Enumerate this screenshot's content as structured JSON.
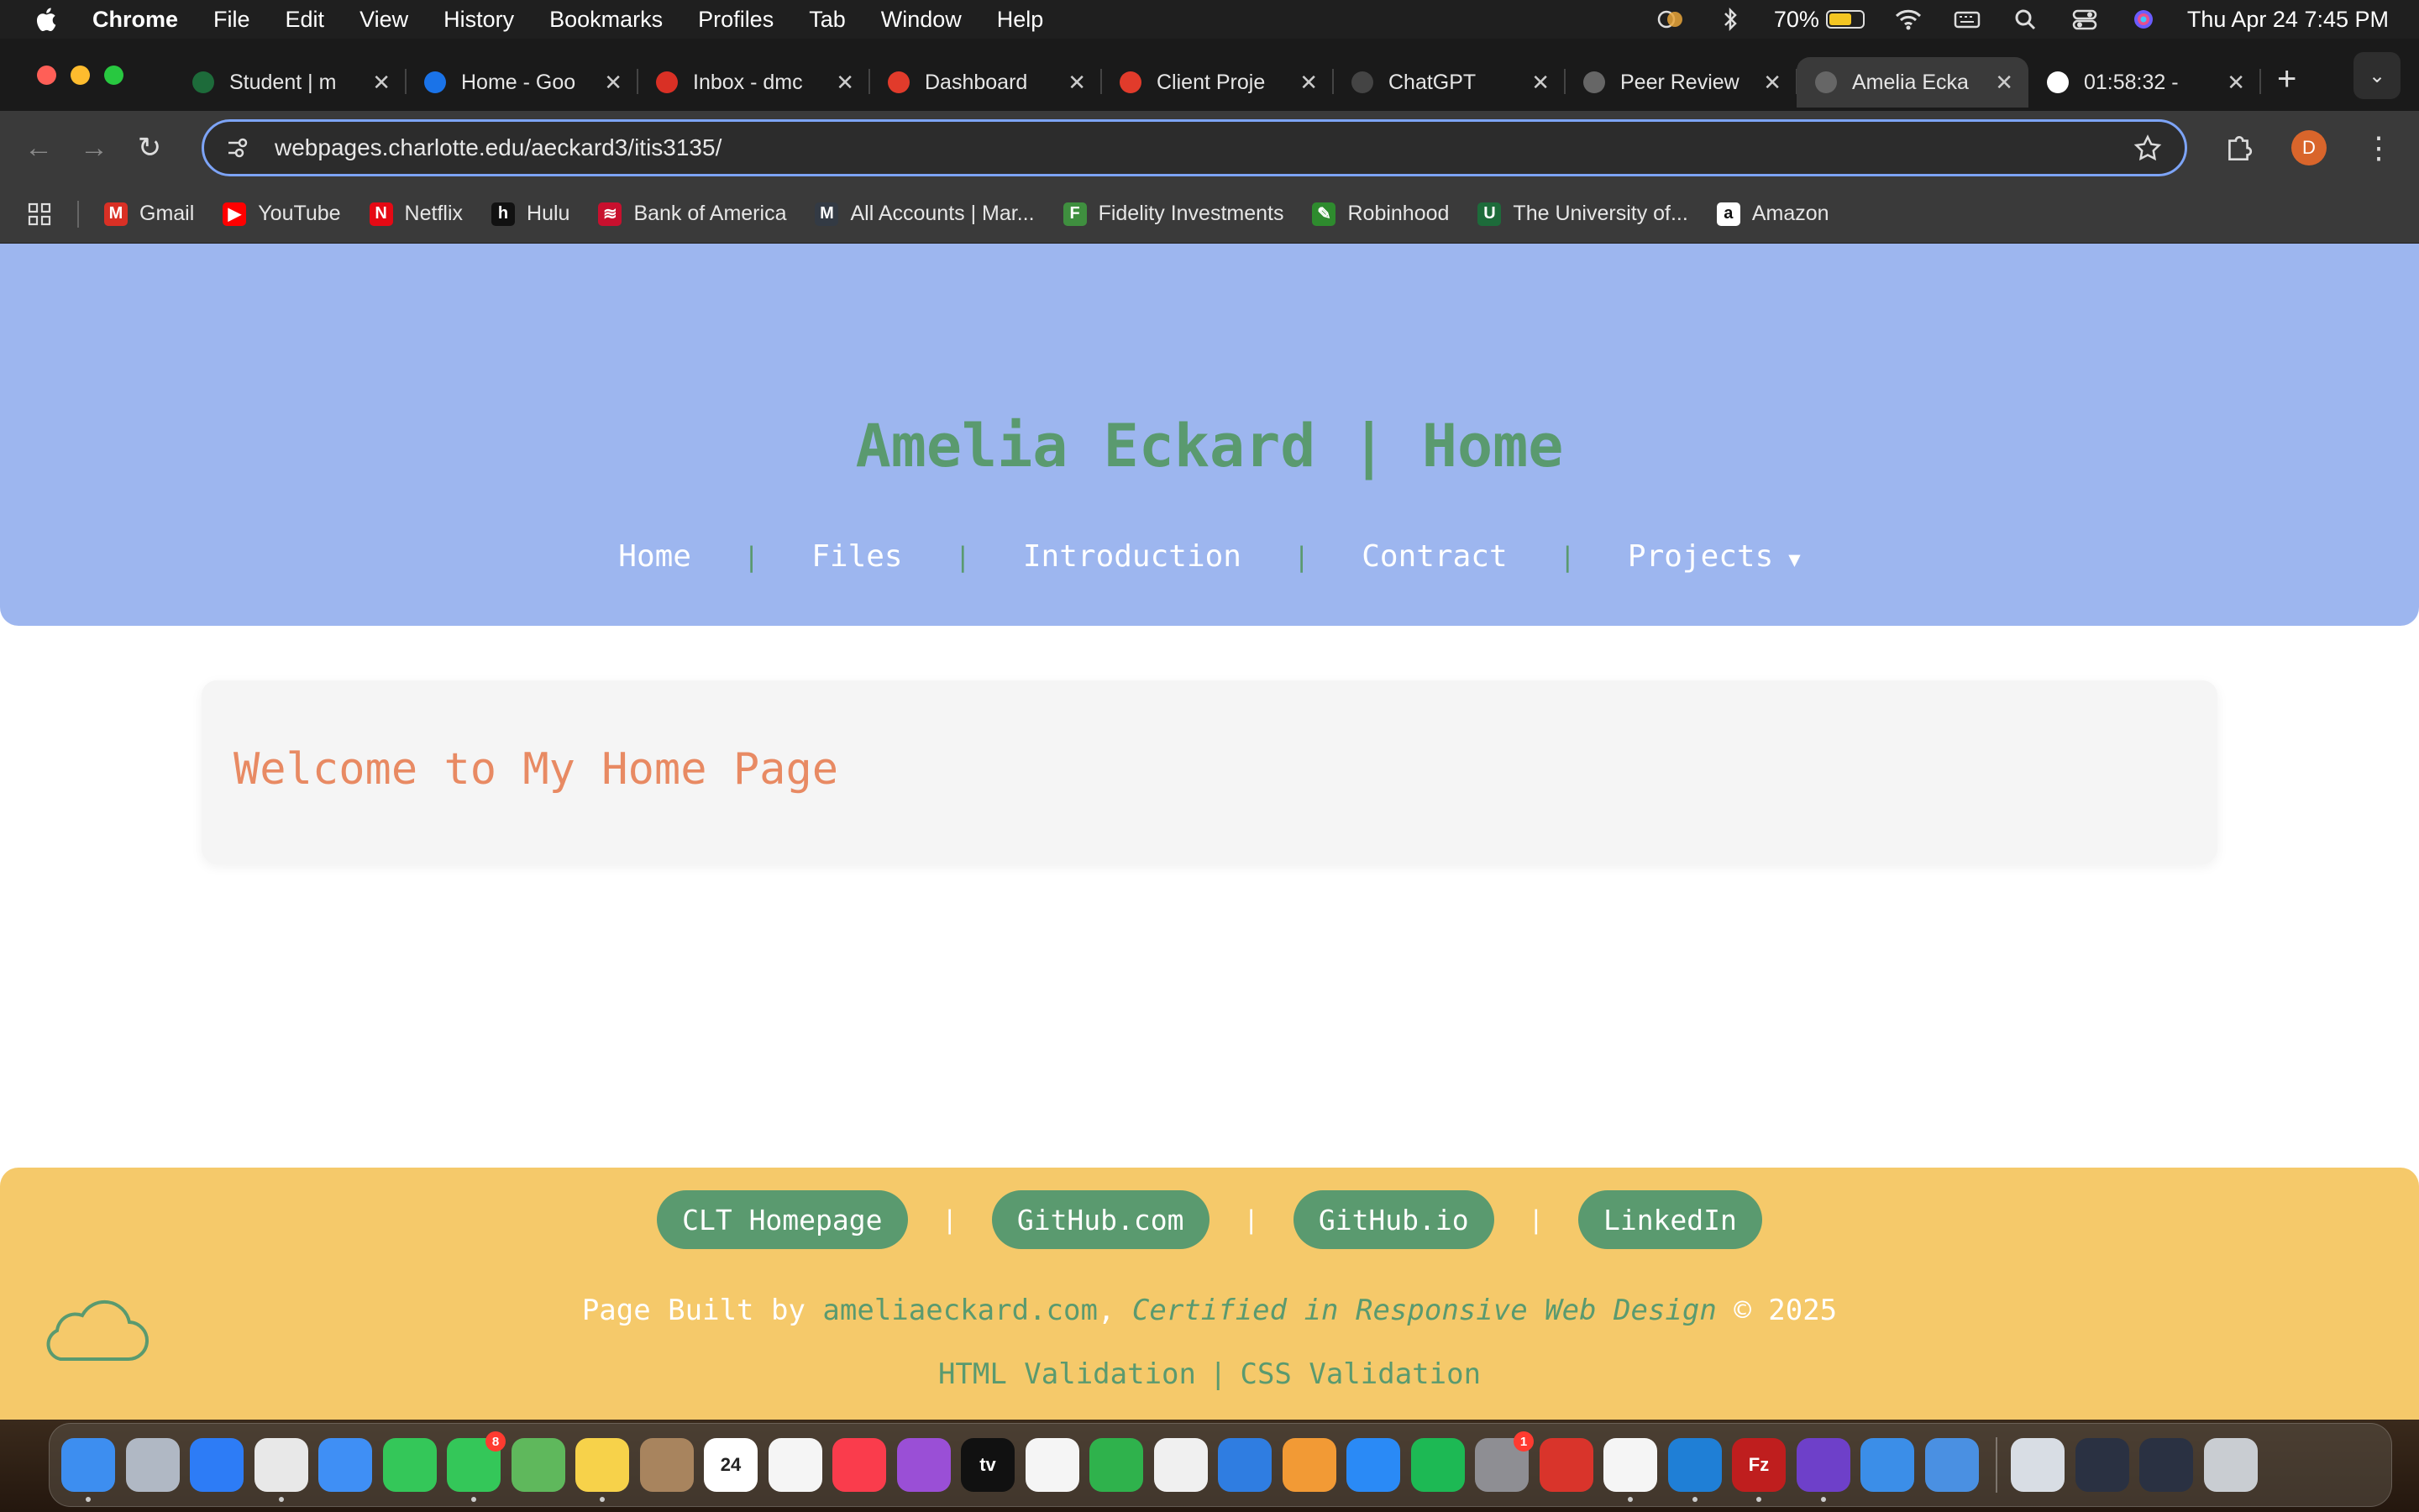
{
  "menubar": {
    "app": "Chrome",
    "items": [
      "File",
      "Edit",
      "View",
      "History",
      "Bookmarks",
      "Profiles",
      "Tab",
      "Window",
      "Help"
    ],
    "battery_percent": "70%",
    "battery_level": 0.7,
    "datetime": "Thu Apr 24  7:45 PM"
  },
  "tabs": [
    {
      "label": "Student | m",
      "icon": "student-icon",
      "color": "#1d6b3a",
      "active": false
    },
    {
      "label": "Home - Goo",
      "icon": "google-drive-icon",
      "color": "#1a73e8",
      "active": false
    },
    {
      "label": "Inbox - dmc",
      "icon": "gmail-icon",
      "color": "#d93025",
      "active": false
    },
    {
      "label": "Dashboard",
      "icon": "canvas-icon",
      "color": "#e13b2b",
      "active": false
    },
    {
      "label": "Client Proje",
      "icon": "canvas-icon",
      "color": "#e13b2b",
      "active": false
    },
    {
      "label": "ChatGPT",
      "icon": "openai-icon",
      "color": "#444444",
      "active": false
    },
    {
      "label": "Peer Review",
      "icon": "globe-icon",
      "color": "#666666",
      "active": false
    },
    {
      "label": "Amelia Ecka",
      "icon": "globe-icon",
      "color": "#666666",
      "active": true
    },
    {
      "label": "01:58:32 - ",
      "icon": "google-icon",
      "color": "#ffffff",
      "active": false
    }
  ],
  "address_bar": {
    "url": "webpages.charlotte.edu/aeckard3/itis3135/"
  },
  "profile_initial": "D",
  "bookmarks": [
    {
      "label": "Gmail",
      "icon": "gmail-icon",
      "color": "#d93025",
      "glyph": "M"
    },
    {
      "label": "YouTube",
      "icon": "youtube-icon",
      "color": "#ff0000",
      "glyph": "▶"
    },
    {
      "label": "Netflix",
      "icon": "netflix-icon",
      "color": "#e50914",
      "glyph": "N"
    },
    {
      "label": "Hulu",
      "icon": "hulu-icon",
      "color": "#111111",
      "glyph": "h"
    },
    {
      "label": "Bank of America",
      "icon": "bank-of-america-icon",
      "color": "#c8102e",
      "glyph": "≋"
    },
    {
      "label": "All Accounts | Mar...",
      "icon": "marcus-icon",
      "color": "#333a44",
      "glyph": "M"
    },
    {
      "label": "Fidelity Investments",
      "icon": "fidelity-icon",
      "color": "#3f8f3f",
      "glyph": "F"
    },
    {
      "label": "Robinhood",
      "icon": "robinhood-icon",
      "color": "#2e8b2e",
      "glyph": "✎"
    },
    {
      "label": "The University of...",
      "icon": "unc-charlotte-icon",
      "color": "#1d6b3a",
      "glyph": "U"
    },
    {
      "label": "Amazon",
      "icon": "amazon-icon",
      "color": "#ffffff",
      "glyph": "a"
    }
  ],
  "site": {
    "title": "Amelia Eckard | Home",
    "nav": [
      "Home",
      "Files",
      "Introduction",
      "Contract",
      "Projects"
    ],
    "nav_caret": "▼",
    "nav_separator": "|",
    "welcome_heading": "Welcome to My Home Page",
    "footer": {
      "links": [
        "CLT Homepage",
        "GitHub.com",
        "GitHub.io",
        "LinkedIn"
      ],
      "credit_prefix": "Page Built by ",
      "credit_link": "ameliaeckard.com",
      "credit_comma": ", ",
      "credit_cert": "Certified in Responsive Web Design",
      "credit_suffix": " © 2025",
      "validation": [
        "HTML Validation",
        "CSS Validation"
      ]
    }
  },
  "colors": {
    "header_bg": "#9db6ef",
    "accent_green": "#5a9a6f",
    "welcome_orange": "#e88a63",
    "footer_bg": "#f5c96a"
  },
  "dock": {
    "apps": [
      {
        "name": "finder-icon",
        "color": "#3d8ef0",
        "running": true
      },
      {
        "name": "launchpad-icon",
        "color": "#b0b8c4",
        "running": false
      },
      {
        "name": "safari-icon",
        "color": "#2d7cf6",
        "running": false
      },
      {
        "name": "chrome-icon",
        "color": "#e8e8e8",
        "running": true
      },
      {
        "name": "mail-icon",
        "color": "#3f8ff5",
        "running": false
      },
      {
        "name": "facetime-icon",
        "color": "#34c759",
        "running": false
      },
      {
        "name": "messages-icon",
        "color": "#34c759",
        "running": true,
        "badge": "8"
      },
      {
        "name": "maps-icon",
        "color": "#5fb85c",
        "running": false
      },
      {
        "name": "notes-icon",
        "color": "#f7d24a",
        "running": true
      },
      {
        "name": "contacts-icon",
        "color": "#a8845e",
        "running": false
      },
      {
        "name": "calendar-icon",
        "color": "#ffffff",
        "running": false,
        "label": "24"
      },
      {
        "name": "reminders-icon",
        "color": "#f5f5f5",
        "running": false
      },
      {
        "name": "music-icon",
        "color": "#fa3c4c",
        "running": false
      },
      {
        "name": "podcasts-icon",
        "color": "#9a4fd6",
        "running": false
      },
      {
        "name": "apple-tv-icon",
        "color": "#111111",
        "running": false,
        "label": "tv"
      },
      {
        "name": "news-icon",
        "color": "#f5f5f5",
        "running": false
      },
      {
        "name": "numbers-icon",
        "color": "#2fb24c",
        "running": false
      },
      {
        "name": "photos-icon",
        "color": "#f0f0f0",
        "running": false
      },
      {
        "name": "keynote-icon",
        "color": "#2f7de1",
        "running": false
      },
      {
        "name": "pages-icon",
        "color": "#f29a35",
        "running": false
      },
      {
        "name": "app-store-icon",
        "color": "#2a8af6",
        "running": false
      },
      {
        "name": "spotify-icon",
        "color": "#1db954",
        "running": false
      },
      {
        "name": "system-settings-icon",
        "color": "#8e8e93",
        "running": false,
        "badge": "1"
      },
      {
        "name": "photo-booth-icon",
        "color": "#d9342b",
        "running": false
      },
      {
        "name": "chatgpt-icon",
        "color": "#f5f5f5",
        "running": true
      },
      {
        "name": "vscode-icon",
        "color": "#1f7fd6",
        "running": true
      },
      {
        "name": "filezilla-icon",
        "color": "#bf1e1e",
        "running": true,
        "label": "Fz"
      },
      {
        "name": "github-desktop-icon",
        "color": "#6e40c9",
        "running": true
      },
      {
        "name": "xcode-icon",
        "color": "#3b8ee8",
        "running": false
      },
      {
        "name": "simulator-icon",
        "color": "#4a90e2",
        "running": false
      }
    ],
    "recent": [
      {
        "name": "preview-icon",
        "color": "#d8dde4"
      },
      {
        "name": "recent-window-icon",
        "color": "#2a3142"
      },
      {
        "name": "recent-window-icon",
        "color": "#2a3142"
      },
      {
        "name": "trash-icon",
        "color": "#c9cdd2"
      }
    ]
  }
}
